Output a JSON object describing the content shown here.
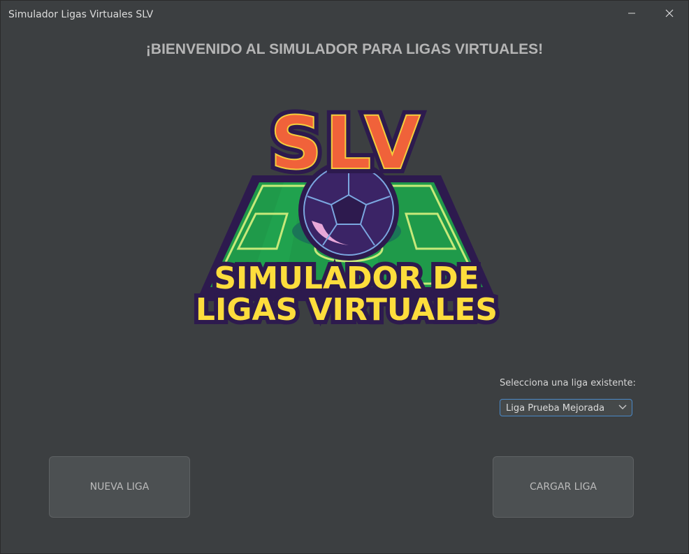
{
  "window": {
    "title": "Simulador Ligas Virtuales SLV"
  },
  "main": {
    "heading": "¡BIENVENIDO AL SIMULADOR PARA LIGAS VIRTUALES!",
    "logo": {
      "acronym": "SLV",
      "line1": "SIMULADOR DE",
      "line2": "LIGAS VIRTUALES"
    }
  },
  "league_select": {
    "label": "Selecciona una liga existente:",
    "selected": "Liga Prueba Mejorada"
  },
  "buttons": {
    "new_league": "NUEVA LIGA",
    "load_league": "CARGAR LIGA"
  },
  "colors": {
    "background": "#3c3f41",
    "accent": "#4a88c7",
    "logo_orange": "#f0623a",
    "logo_yellow": "#fddd3c",
    "logo_purple": "#2d1a4e",
    "pitch_green": "#1f9a4a"
  },
  "icons": [
    "minimize-icon",
    "close-icon",
    "chevron-down-icon",
    "soccer-ball-icon"
  ]
}
